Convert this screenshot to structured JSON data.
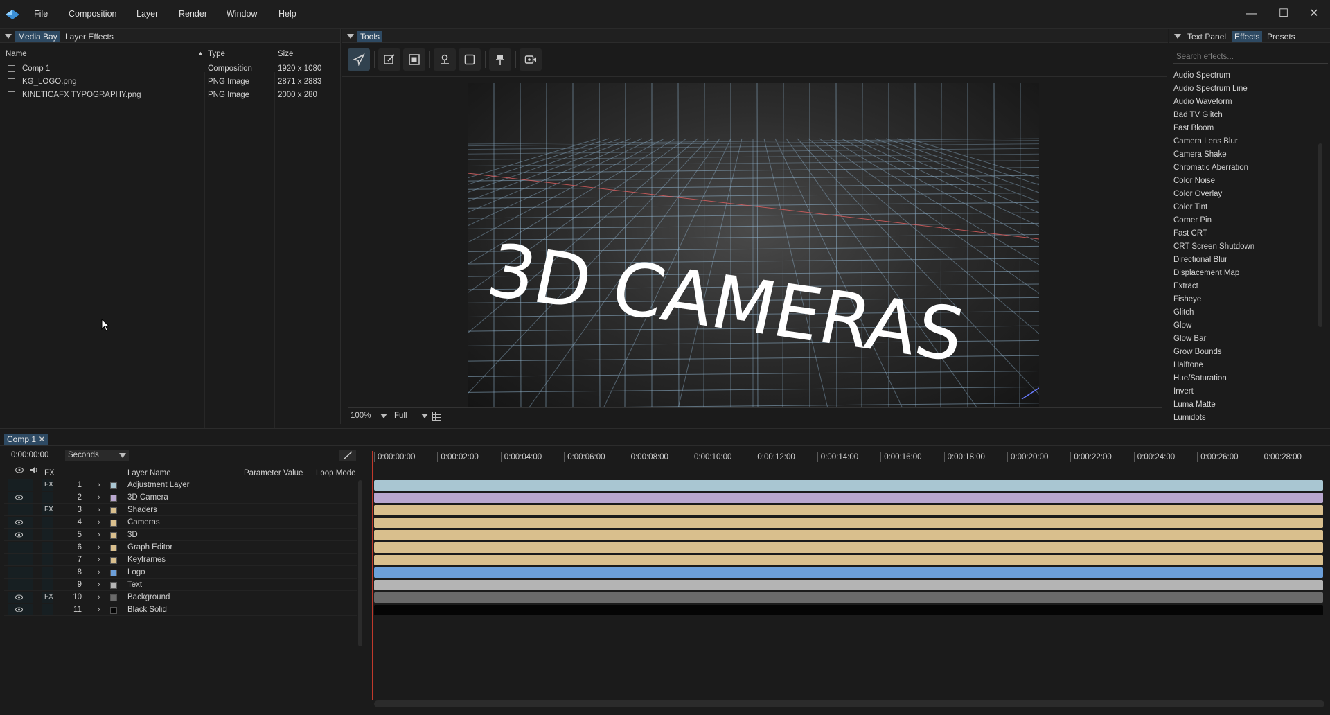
{
  "menu": [
    "File",
    "Composition",
    "Layer",
    "Render",
    "Window",
    "Help"
  ],
  "media_bay": {
    "tabs": [
      "Media Bay",
      "Layer Effects"
    ],
    "columns": [
      "Name",
      "Type",
      "Size"
    ],
    "rows": [
      {
        "name": "Comp 1",
        "type": "Composition",
        "size": "1920 x 1080"
      },
      {
        "name": "KG_LOGO.png",
        "type": "PNG Image",
        "size": "2871 x 2883"
      },
      {
        "name": "KINETICAFX TYPOGRAPHY.png",
        "type": "PNG Image",
        "size": "2000 x 280"
      }
    ]
  },
  "tools": {
    "tab": "Tools",
    "buttons": [
      "select-icon",
      "edit-icon",
      "mask-icon",
      "anchor-icon",
      "rectangle-icon",
      "pin-icon",
      "camera-icon"
    ]
  },
  "viewer": {
    "canvas_text": "3D CAMERAS",
    "zoom": "100%",
    "quality": "Full"
  },
  "effects_panel": {
    "tabs": [
      "Text Panel",
      "Effects",
      "Presets"
    ],
    "search_placeholder": "Search effects...",
    "items": [
      "Audio Spectrum",
      "Audio Spectrum Line",
      "Audio Waveform",
      "Bad TV Glitch",
      "Fast Bloom",
      "Camera Lens Blur",
      "Camera Shake",
      "Chromatic Aberration",
      "Color Noise",
      "Color Overlay",
      "Color Tint",
      "Corner Pin",
      "Fast CRT",
      "CRT Screen Shutdown",
      "Directional Blur",
      "Displacement Map",
      "Extract",
      "Fisheye",
      "Glitch",
      "Glow",
      "Glow Bar",
      "Grow Bounds",
      "Halftone",
      "Hue/Saturation",
      "Invert",
      "Luma Matte",
      "Lumidots"
    ]
  },
  "timeline": {
    "tab": "Comp 1",
    "current_time": "0:00:00:00",
    "time_unit": "Seconds",
    "headers": {
      "fx": "FX",
      "layer_name": "Layer Name",
      "parameter_value": "Parameter Value",
      "loop_mode": "Loop Mode"
    },
    "ruler": [
      "0:00:00:00",
      "0:00:02:00",
      "0:00:04:00",
      "0:00:06:00",
      "0:00:08:00",
      "0:00:10:00",
      "0:00:12:00",
      "0:00:14:00",
      "0:00:16:00",
      "0:00:18:00",
      "0:00:20:00",
      "0:00:22:00",
      "0:00:24:00",
      "0:00:26:00",
      "0:00:28:00"
    ],
    "layers": [
      {
        "num": "1",
        "name": "Adjustment Layer",
        "color": "#a9c6d2",
        "visible": false,
        "fx": "FX"
      },
      {
        "num": "2",
        "name": "3D Camera",
        "color": "#b9a7cf",
        "visible": true,
        "fx": ""
      },
      {
        "num": "3",
        "name": "Shaders",
        "color": "#d9bf8d",
        "visible": false,
        "fx": "FX"
      },
      {
        "num": "4",
        "name": "Cameras",
        "color": "#d9bf8d",
        "visible": true,
        "fx": ""
      },
      {
        "num": "5",
        "name": "3D",
        "color": "#d9bf8d",
        "visible": true,
        "fx": ""
      },
      {
        "num": "6",
        "name": "Graph Editor",
        "color": "#d9bf8d",
        "visible": false,
        "fx": ""
      },
      {
        "num": "7",
        "name": "Keyframes",
        "color": "#d9bf8d",
        "visible": false,
        "fx": ""
      },
      {
        "num": "8",
        "name": "Logo",
        "color": "#6c9fd9",
        "visible": false,
        "fx": ""
      },
      {
        "num": "9",
        "name": "Text",
        "color": "#b4b4b4",
        "visible": false,
        "fx": ""
      },
      {
        "num": "10",
        "name": "Background",
        "color": "#6a6a6a",
        "visible": true,
        "fx": "FX"
      },
      {
        "num": "11",
        "name": "Black Solid",
        "color": "#050505",
        "visible": true,
        "fx": ""
      }
    ],
    "track_colors": [
      "#a9c6d2",
      "#b9a7cf",
      "#d9bf8d",
      "#d9bf8d",
      "#d9bf8d",
      "#d9bf8d",
      "#d9bf8d",
      "#6c9fd9",
      "#b4b4b4",
      "#6a6a6a",
      "#050505"
    ]
  }
}
